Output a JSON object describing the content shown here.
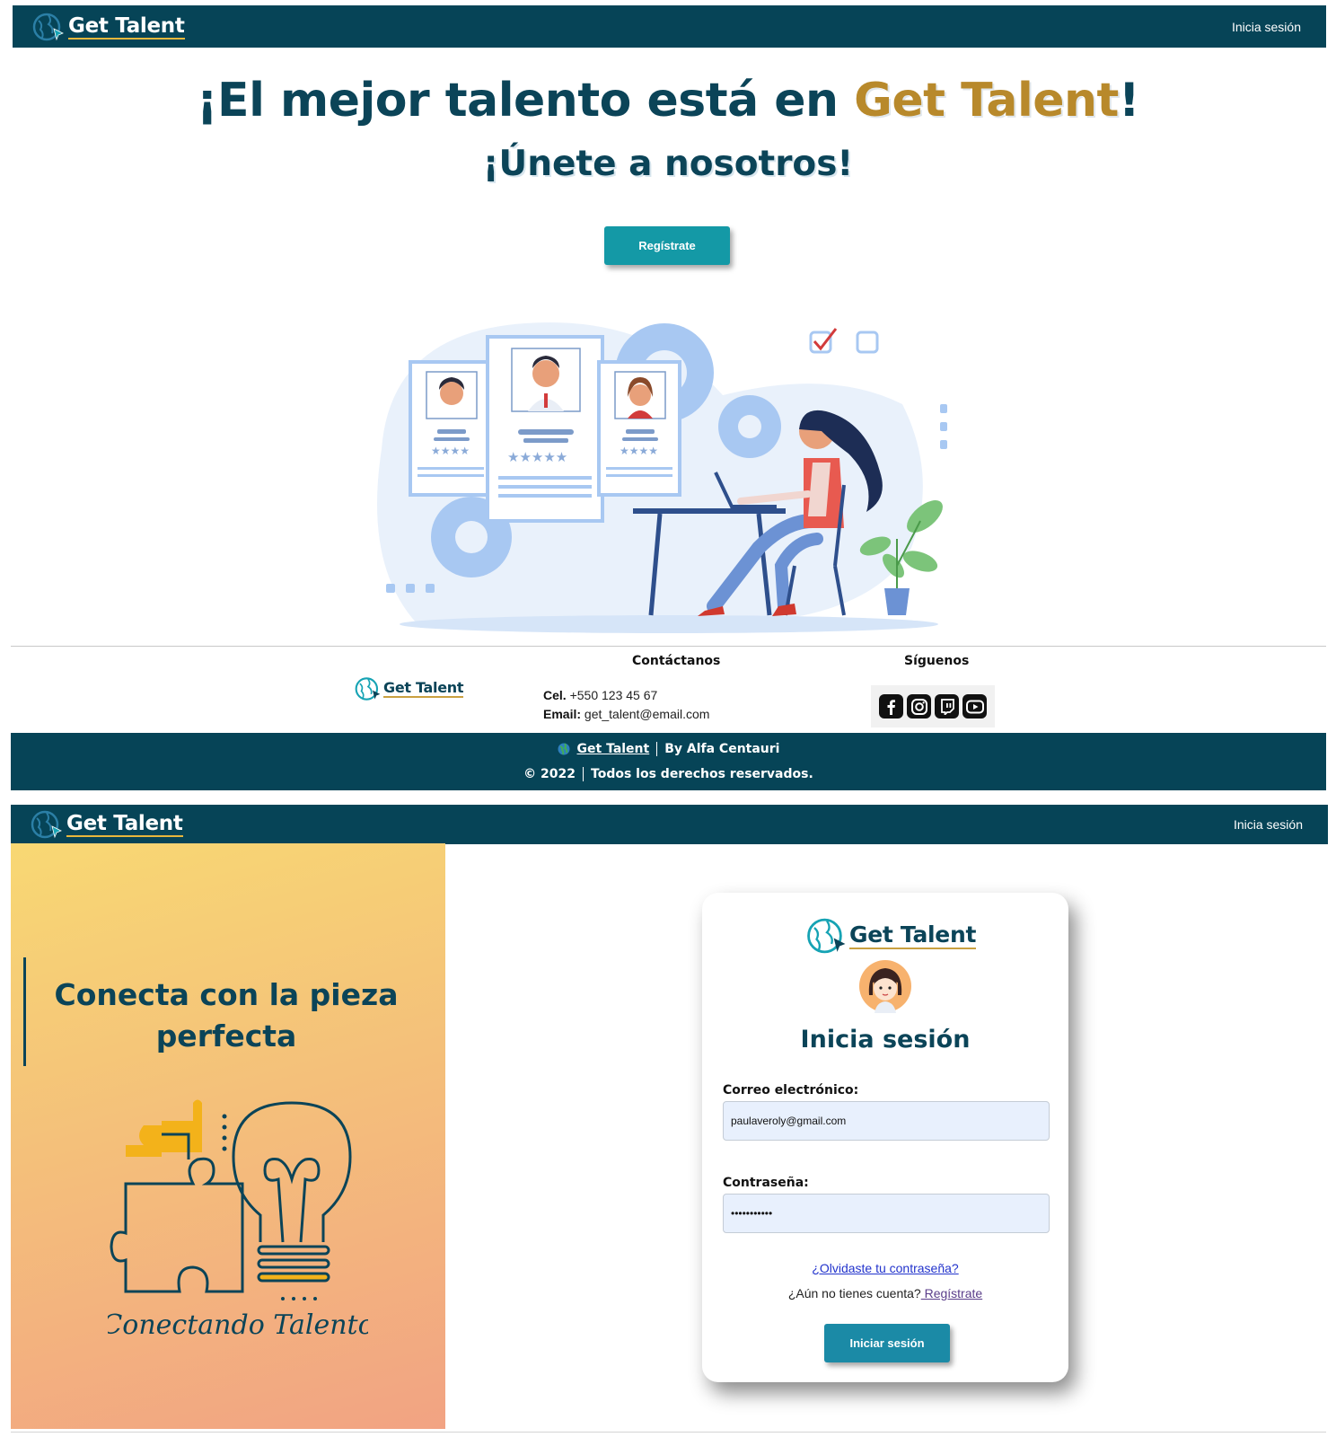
{
  "brand": {
    "name": "Get Talent"
  },
  "nav": {
    "login_label": "Inicia sesión"
  },
  "landing": {
    "hero_title_prefix": "¡El mejor talento está en ",
    "hero_title_brand": "Get Talent",
    "hero_title_suffix": "!",
    "hero_subtitle": "¡Únete a nosotros!",
    "register_button": "Regístrate"
  },
  "footer": {
    "contact_heading": "Contáctanos",
    "follow_heading": "Síguenos",
    "phone_label": "Cel.",
    "phone_value": "+550 123 45 67",
    "email_label": "Email:",
    "email_value": "get_talent@email.com",
    "social_icons": [
      "facebook-icon",
      "instagram-icon",
      "twitch-icon",
      "youtube-icon"
    ],
    "brand_link": "Get Talent",
    "byline": "By Alfa Centauri",
    "copyright": "© 2022",
    "rights": "Todos los derechos reservados."
  },
  "login": {
    "panel_title": "Conecta con la pieza perfecta",
    "panel_tagline": "Conectando Talento",
    "card_title": "Inicia sesión",
    "email_label": "Correo electrónico:",
    "email_value": "paulaveroly@gmail.com",
    "password_label": "Contraseña:",
    "password_value": "•••••••••••",
    "forgot_link": "¿Olvidaste tu contraseña?",
    "no_account_text": "¿Aún no tienes cuenta?",
    "register_link": " Regístrate",
    "submit_button": "Iniciar sesión"
  },
  "colors": {
    "navy": "#064457",
    "teal": "#1499a6",
    "gold": "#b8892b",
    "input_bg": "#e8f0fd"
  }
}
